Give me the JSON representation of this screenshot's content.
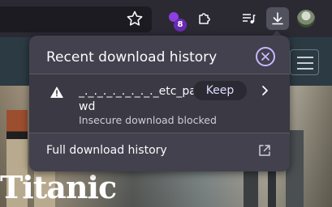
{
  "toolbar": {
    "extension_badge_count": "8",
    "icons": [
      "star-icon",
      "extension-badge-icon",
      "puzzle-icon",
      "media-icon",
      "download-icon",
      "avatar"
    ]
  },
  "page": {
    "title": "Titanic"
  },
  "downloads_panel": {
    "title": "Recent download history",
    "item": {
      "filename": "_._._._._._._._._etc_passwd",
      "status": "Insecure download blocked",
      "keep_label": "Keep"
    },
    "footer_label": "Full download history"
  },
  "colors": {
    "panel_bg": "#42414d",
    "accent": "#c9b8ff",
    "badge": "#6a2ab5"
  }
}
